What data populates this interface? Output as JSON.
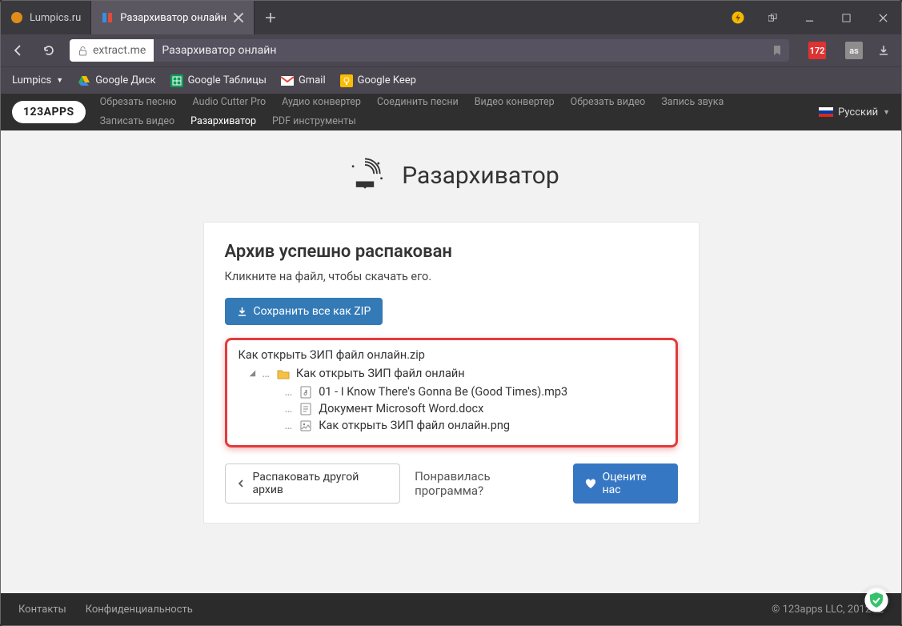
{
  "browser": {
    "tabs": [
      {
        "title": "Lumpics.ru",
        "active": false
      },
      {
        "title": "Разархиватор онлайн",
        "active": true
      }
    ],
    "url_host": "extract.me",
    "url_title": "Разархиватор онлайн",
    "ext_badge": "172",
    "bookmarks": [
      {
        "label": "Lumpics",
        "menu": true
      },
      {
        "label": "Google Диск"
      },
      {
        "label": "Google Таблицы"
      },
      {
        "label": "Gmail"
      },
      {
        "label": "Google Keep"
      }
    ]
  },
  "site": {
    "brand": "123APPS",
    "links": [
      {
        "label": "Обрезать песню"
      },
      {
        "label": "Audio Cutter Pro"
      },
      {
        "label": "Аудио конвертер"
      },
      {
        "label": "Соединить песни"
      },
      {
        "label": "Видео конвертер"
      },
      {
        "label": "Обрезать видео"
      },
      {
        "label": "Запись звука"
      },
      {
        "label": "Записать видео"
      },
      {
        "label": "Разархиватор",
        "active": true
      },
      {
        "label": "PDF инструменты"
      }
    ],
    "lang": "Русский"
  },
  "hero": {
    "title": "Разархиватор"
  },
  "result": {
    "success_title": "Архив успешно распакован",
    "hint": "Кликните на файл, чтобы скачать его.",
    "save_zip_button": "Сохранить все как ZIP",
    "archive_name": "Как открыть ЗИП файл онлайн.zip",
    "folder_name": "Как открыть ЗИП файл онлайн",
    "files": [
      {
        "name": "01 - I Know There's Gonna Be (Good Times).mp3",
        "kind": "audio"
      },
      {
        "name": "Документ Microsoft Word.docx",
        "kind": "doc"
      },
      {
        "name": "Как открыть ЗИП файл онлайн.png",
        "kind": "image"
      }
    ],
    "unpack_another": "Распаковать другой архив",
    "liked": "Понравилась программа?",
    "rate_us": "Оцените нас"
  },
  "footer": {
    "links": [
      "Контакты",
      "Конфиденциальность"
    ],
    "copyright": "© 123apps LLC, 2012–2"
  }
}
